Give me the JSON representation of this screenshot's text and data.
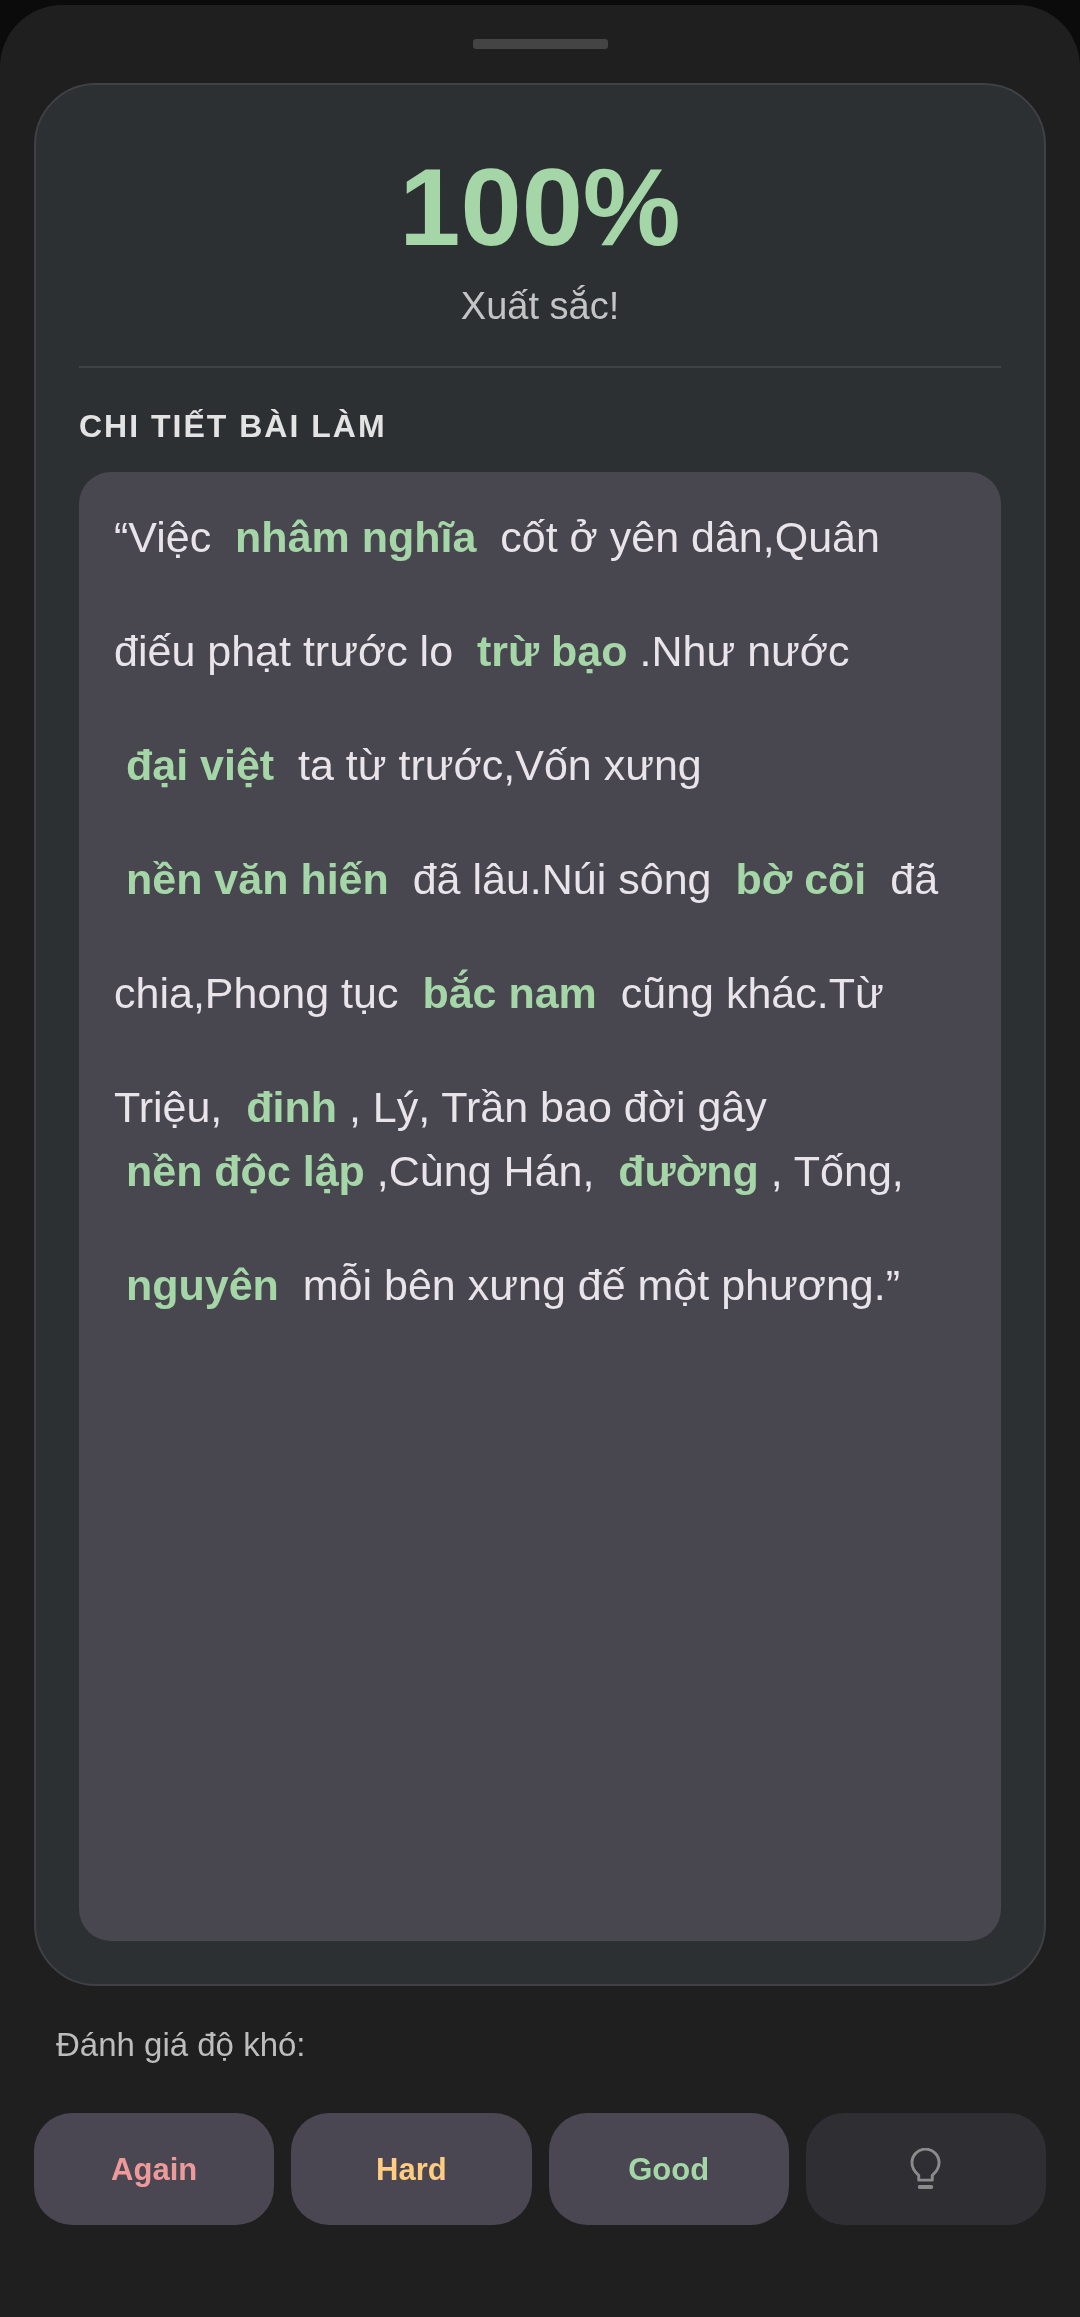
{
  "score": {
    "value": "100%",
    "verdict": "Xuất sắc!"
  },
  "details": {
    "title": "CHI TIẾT BÀI LÀM",
    "paragraphs": [
      [
        "“Việc  **nhâm nghĩa**  cốt ở yên dân,Quân"
      ],
      [
        "điếu phạt trước lo  **trừ bạo** .Như nước"
      ],
      [
        " **đại việt**  ta từ trước,Vốn xưng"
      ],
      [
        " **nền văn hiến**  đã lâu.Núi sông  **bờ cõi**  đã"
      ],
      [
        "chia,Phong tục  **bắc nam**  cũng khác.Từ"
      ],
      [
        "Triệu,  **đinh** , Lý, Trần bao đời gây",
        " **nền độc lập** ,Cùng Hán,  **đường** , Tống,"
      ],
      [
        " **nguyên**  mỗi bên xưng đế một phương.”"
      ]
    ]
  },
  "rating": {
    "label": "Đánh giá độ khó:",
    "buttons": [
      {
        "kind": "text",
        "label": "Again",
        "color": "#ef9a9a"
      },
      {
        "kind": "text",
        "label": "Hard",
        "color": "#ffcc80"
      },
      {
        "kind": "text",
        "label": "Good",
        "color": "#a5d6a7"
      },
      {
        "kind": "icon"
      }
    ]
  }
}
